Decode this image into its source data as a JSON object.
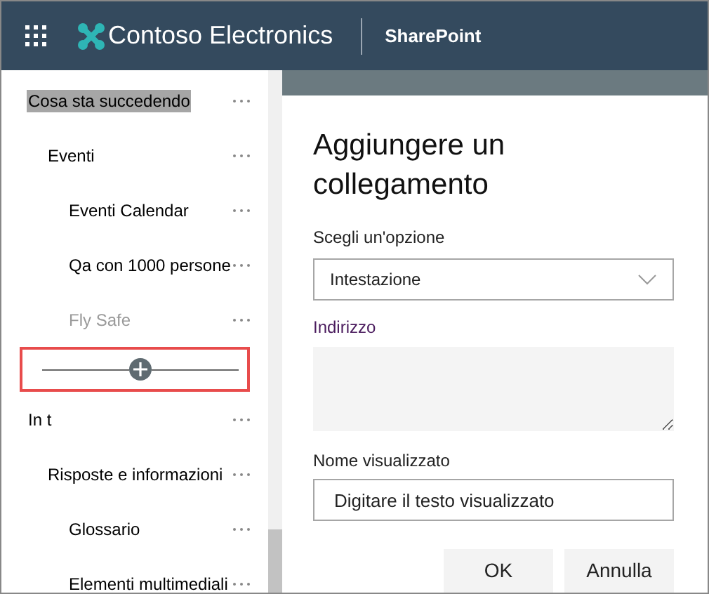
{
  "header": {
    "app_title": "Contoso Electronics",
    "product": "SharePoint"
  },
  "nav": {
    "items": [
      {
        "label": "Cosa sta succedendo",
        "selected": true,
        "disabled": false,
        "children": [
          {
            "label": "Eventi",
            "selected": false,
            "disabled": false,
            "children": [
              {
                "label": "Eventi Calendar",
                "selected": false,
                "disabled": false
              },
              {
                "label": "Qa con 1000 persone",
                "selected": false,
                "disabled": false
              },
              {
                "label": "Fly Safe",
                "selected": false,
                "disabled": true
              }
            ]
          }
        ]
      },
      {
        "label": "In t",
        "selected": false,
        "disabled": false,
        "children": [
          {
            "label": "Risposte e informazioni",
            "selected": false,
            "disabled": false,
            "children": [
              {
                "label": "Glossario",
                "selected": false,
                "disabled": false
              },
              {
                "label": "Elementi multimediali",
                "selected": false,
                "disabled": false
              }
            ]
          }
        ]
      }
    ],
    "insert_marker": {
      "highlighted": true
    }
  },
  "dialog": {
    "title": "Aggiungere un collegamento",
    "option": {
      "label": "Scegli un'opzione",
      "value": "Intestazione"
    },
    "address": {
      "label": "Indirizzo"
    },
    "display_name": {
      "label": "Nome visualizzato",
      "placeholder": "Digitare il testo visualizzato"
    },
    "buttons": [
      "OK",
      "Annulla"
    ]
  }
}
